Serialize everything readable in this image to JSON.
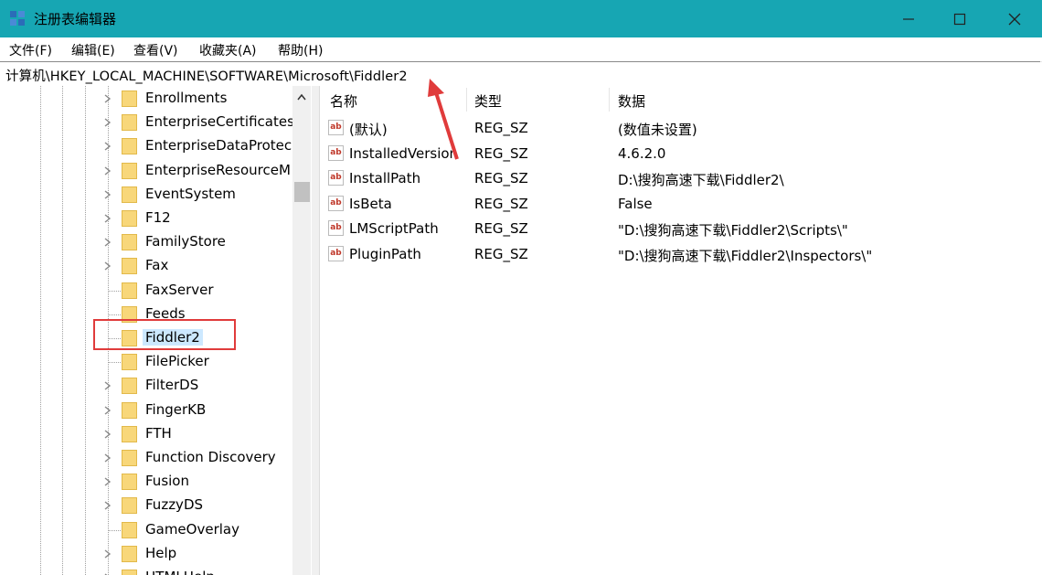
{
  "window": {
    "title": "注册表编辑器",
    "controls": {
      "minimize": "minimize-icon",
      "maximize": "maximize-icon",
      "close": "close-icon"
    }
  },
  "menu": [
    "文件(F)",
    "编辑(E)",
    "查看(V)",
    "收藏夹(A)",
    "帮助(H)"
  ],
  "address": "计算机\\HKEY_LOCAL_MACHINE\\SOFTWARE\\Microsoft\\Fiddler2",
  "tree": {
    "items": [
      {
        "label": "Enrollments",
        "expandable": true
      },
      {
        "label": "EnterpriseCertificates",
        "expandable": true
      },
      {
        "label": "EnterpriseDataProtec",
        "expandable": true
      },
      {
        "label": "EnterpriseResourceM",
        "expandable": true
      },
      {
        "label": "EventSystem",
        "expandable": true
      },
      {
        "label": "F12",
        "expandable": true
      },
      {
        "label": "FamilyStore",
        "expandable": true
      },
      {
        "label": "Fax",
        "expandable": true
      },
      {
        "label": "FaxServer",
        "expandable": false
      },
      {
        "label": "Feeds",
        "expandable": false
      },
      {
        "label": "Fiddler2",
        "expandable": false,
        "selected": true
      },
      {
        "label": "FilePicker",
        "expandable": false
      },
      {
        "label": "FilterDS",
        "expandable": true
      },
      {
        "label": "FingerKB",
        "expandable": true
      },
      {
        "label": "FTH",
        "expandable": true
      },
      {
        "label": "Function Discovery",
        "expandable": true
      },
      {
        "label": "Fusion",
        "expandable": true
      },
      {
        "label": "FuzzyDS",
        "expandable": true
      },
      {
        "label": "GameOverlay",
        "expandable": false
      },
      {
        "label": "Help",
        "expandable": true
      },
      {
        "label": "HTMLHelp",
        "expandable": true
      }
    ]
  },
  "values": {
    "headers": {
      "name": "名称",
      "type": "类型",
      "data": "数据"
    },
    "rows": [
      {
        "name": "(默认)",
        "type": "REG_SZ",
        "data": "(数值未设置)"
      },
      {
        "name": "InstalledVersion",
        "type": "REG_SZ",
        "data": "4.6.2.0"
      },
      {
        "name": "InstallPath",
        "type": "REG_SZ",
        "data": "D:\\搜狗高速下载\\Fiddler2\\"
      },
      {
        "name": "IsBeta",
        "type": "REG_SZ",
        "data": "False"
      },
      {
        "name": "LMScriptPath",
        "type": "REG_SZ",
        "data": "\"D:\\搜狗高速下载\\Fiddler2\\Scripts\\\""
      },
      {
        "name": "PluginPath",
        "type": "REG_SZ",
        "data": "\"D:\\搜狗高速下载\\Fiddler2\\Inspectors\\\""
      }
    ],
    "icon": "string-value-icon",
    "icon_text": "ab"
  },
  "colors": {
    "titlebar": "#17a6b3",
    "annotation": "#e03b3b",
    "selection": "#cce8ff"
  }
}
